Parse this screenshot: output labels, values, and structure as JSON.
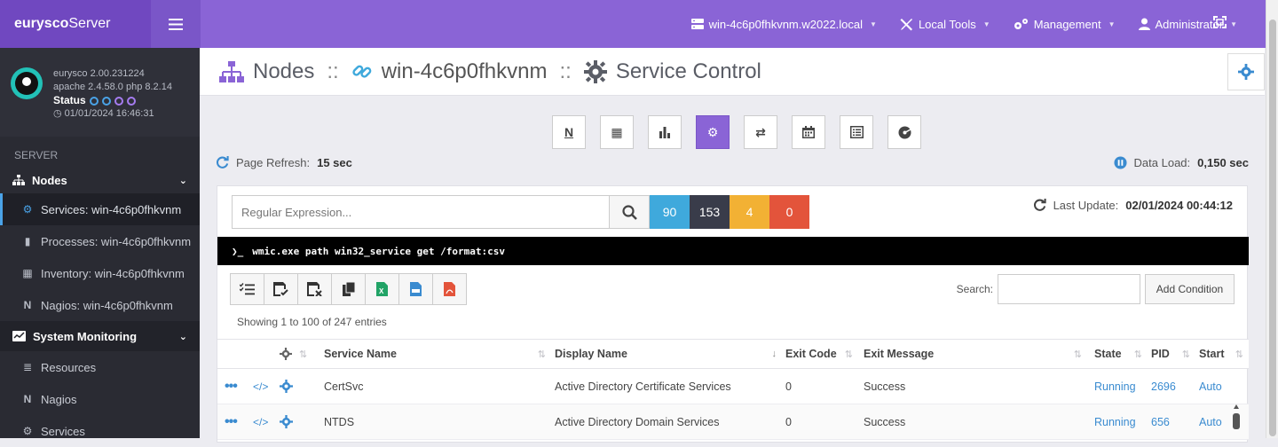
{
  "app": {
    "brand_bold": "eurysco",
    "brand_rest": "Server"
  },
  "topnav": {
    "host": "win-4c6p0fhkvnm.w2022.local",
    "local_tools": "Local Tools",
    "management": "Management",
    "user": "Administrator"
  },
  "profile": {
    "version": "eurysco 2.00.231224",
    "stack": "apache 2.4.58.0  php 8.2.14",
    "status_label": "Status",
    "datetime": "01/01/2024 16:46:31"
  },
  "sidebar": {
    "section": "SERVER",
    "group_nodes": "Nodes",
    "items": [
      {
        "label": "Services: win-4c6p0fhkvnm"
      },
      {
        "label": "Processes: win-4c6p0fhkvnm"
      },
      {
        "label": "Inventory: win-4c6p0fhkvnm"
      },
      {
        "label": "Nagios: win-4c6p0fhkvnm"
      }
    ],
    "group_monitoring": "System Monitoring",
    "mon_items": [
      {
        "label": "Resources"
      },
      {
        "label": "Nagios"
      },
      {
        "label": "Services"
      }
    ]
  },
  "header": {
    "part1": "Nodes",
    "sep": "::",
    "node": "win-4c6p0fhkvnm",
    "part3": "Service Control"
  },
  "refresh": {
    "label": "Page Refresh:",
    "value": "15 sec"
  },
  "dataload": {
    "label": "Data Load:",
    "value": "0,150 sec"
  },
  "search": {
    "placeholder": "Regular Expression..."
  },
  "counters": {
    "running": "90",
    "total": "153",
    "warning": "4",
    "error": "0"
  },
  "lastupdate": {
    "label": "Last Update:",
    "value": "02/01/2024 00:44:12"
  },
  "command": {
    "prompt": "❯_",
    "text": "wmic.exe path win32_service get /format:csv"
  },
  "tabletools": {
    "search_label": "Search:",
    "add_condition": "Add Condition",
    "showing": "Showing 1 to 100 of 247 entries"
  },
  "table": {
    "headers": [
      "Service Name",
      "Display Name",
      "Exit Code",
      "Exit Message",
      "State",
      "PID",
      "Start"
    ],
    "rows": [
      [
        "CertSvc",
        "Active Directory Certificate Services",
        "0",
        "Success",
        "Running",
        "2696",
        "Auto"
      ],
      [
        "NTDS",
        "Active Directory Domain Services",
        "0",
        "Success",
        "Running",
        "656",
        "Auto"
      ]
    ]
  },
  "colors": {
    "accent": "#8a64d6",
    "blue": "#3fa9dc",
    "dark": "#393c4a",
    "yellow": "#f2b134",
    "red": "#e3543b"
  }
}
